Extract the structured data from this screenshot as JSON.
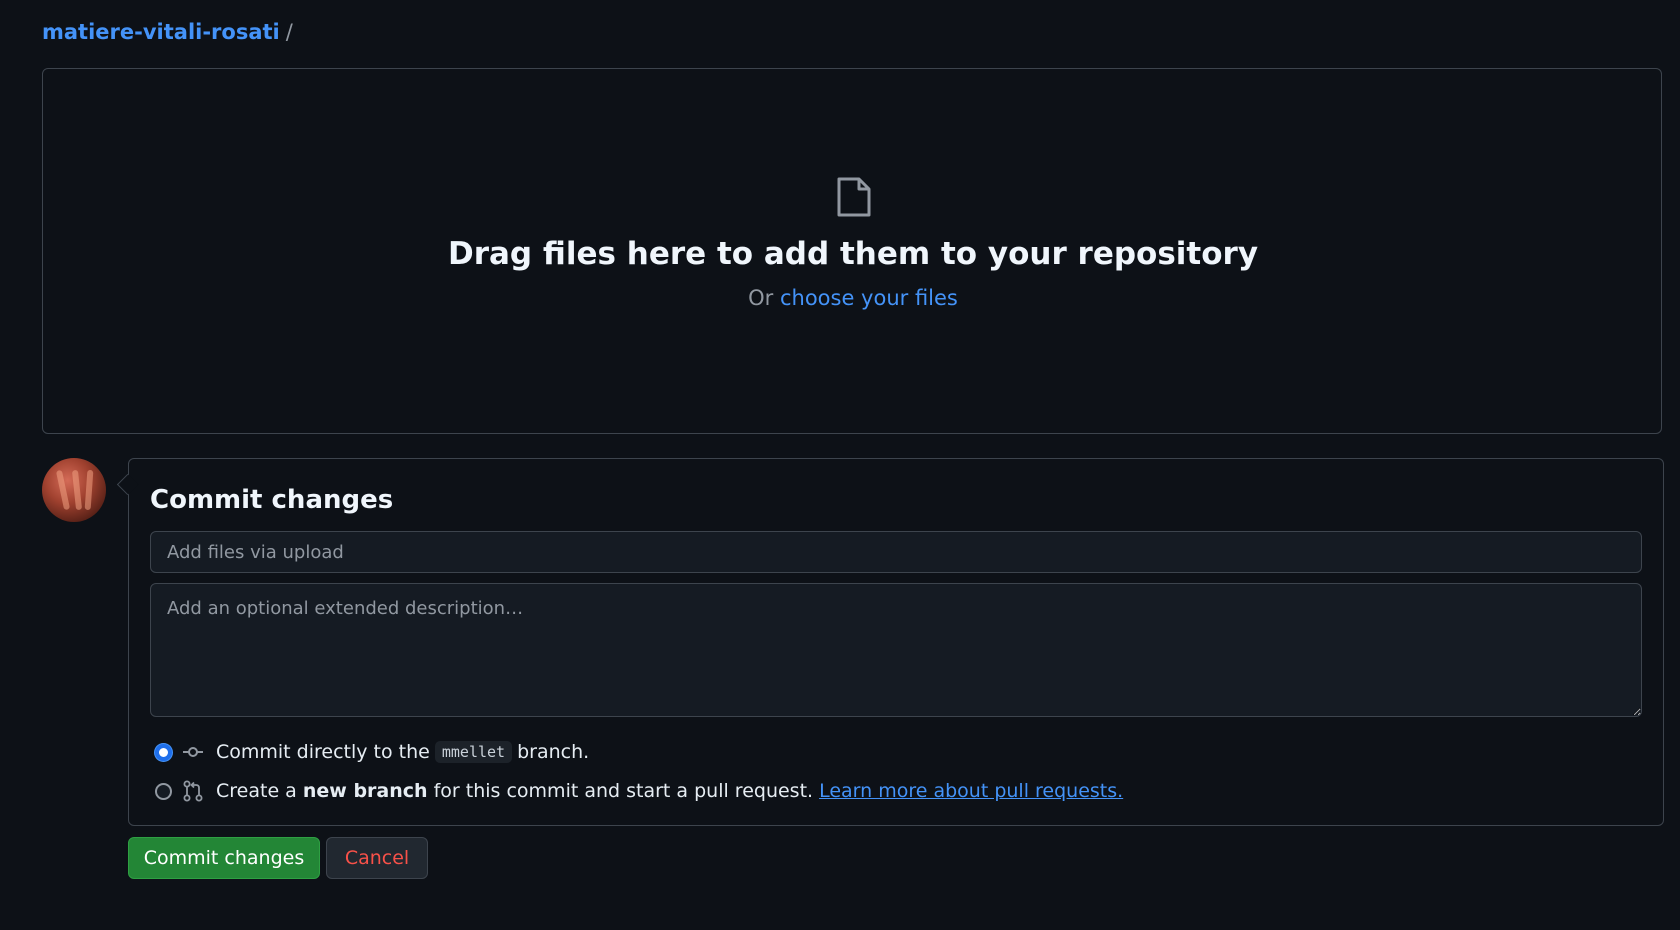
{
  "breadcrumb": {
    "repo_name": "matiere-vitali-rosati",
    "separator": "/"
  },
  "dropzone": {
    "icon": "file-icon",
    "title": "Drag files here to add them to your repository",
    "subtitle_prefix": "Or",
    "choose_link": "choose your files"
  },
  "commit": {
    "title": "Commit changes",
    "summary_placeholder": "Add files via upload",
    "summary_value": "",
    "description_placeholder": "Add an optional extended description…",
    "description_value": "",
    "option_direct": {
      "selected": true,
      "icon": "git-commit-icon",
      "text_before": "Commit directly to the",
      "branch": "mmellet",
      "text_after": "branch."
    },
    "option_new_branch": {
      "selected": false,
      "icon": "git-pull-request-icon",
      "text_before": "Create a",
      "bold": "new branch",
      "text_after": "for this commit and start a pull request.",
      "link": "Learn more about pull requests."
    }
  },
  "buttons": {
    "commit_label": "Commit changes",
    "cancel_label": "Cancel"
  },
  "colors": {
    "background": "#0d1117",
    "accent_link": "#4493f8",
    "primary_button": "#238636",
    "danger_text": "#f85149",
    "border": "#3d444d"
  }
}
